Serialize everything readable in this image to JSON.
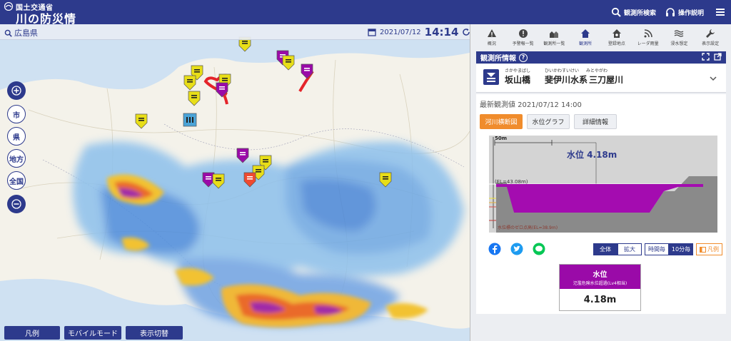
{
  "header": {
    "org": "国土交通省",
    "title": "川の防災情報",
    "search_label": "観測所検索",
    "help_label": "操作説明",
    "menu_icon": "hamburger-icon"
  },
  "map": {
    "prefecture": "広島県",
    "date": "2021/07/12",
    "time": "14:14",
    "scale_buttons": [
      "市",
      "県",
      "地方",
      "全国"
    ],
    "bottom_buttons": [
      "凡例",
      "モバイルモード",
      "表示切替"
    ],
    "icons": [
      "search-icon",
      "calendar-icon",
      "refresh-icon",
      "zoom-in-icon",
      "zoom-out-icon"
    ]
  },
  "panel": {
    "nav": [
      {
        "label": "概況",
        "icon": "warning-triangle-icon"
      },
      {
        "label": "予警報一覧",
        "icon": "alert-circle-icon"
      },
      {
        "label": "観測所一覧",
        "icon": "building-list-icon"
      },
      {
        "label": "観測所",
        "icon": "home-icon"
      },
      {
        "label": "登録地点",
        "icon": "home-star-icon"
      },
      {
        "label": "レーダ雨量",
        "icon": "radar-icon"
      },
      {
        "label": "浸水想定",
        "icon": "wave-icon"
      },
      {
        "label": "表示設定",
        "icon": "wrench-icon"
      }
    ],
    "section_title": "観測所情報",
    "station": {
      "ruby_name": "さかやまばし",
      "ruby_river": "ひいかわすいけい",
      "ruby_river2": "みとやがわ",
      "name": "坂山橋",
      "river_system": "斐伊川水系",
      "river": "三刀屋川"
    },
    "latest_label": "最新観測値 2021/07/12 14:00",
    "tabs": [
      "河川横断図",
      "水位グラフ",
      "詳細情報"
    ],
    "diagram": {
      "width_label": "50m",
      "level_label": "水位 4.18m",
      "el_label": "(EL=43.08m)",
      "zero_label": "水位標のゼロ点高(EL=38.9m)"
    },
    "controls": {
      "all": "全体",
      "zoom": "拡大",
      "interval_a": "時間毎",
      "interval_b": "10分毎",
      "legend": "凡例"
    },
    "level_card": {
      "title": "水位",
      "subtitle": "氾濫危険水位超過(Lv4相当)",
      "value": "4.18m"
    },
    "colors": {
      "brand": "#2d3a8c",
      "accent": "#f08c2c",
      "danger": "#9a0aa8"
    }
  }
}
